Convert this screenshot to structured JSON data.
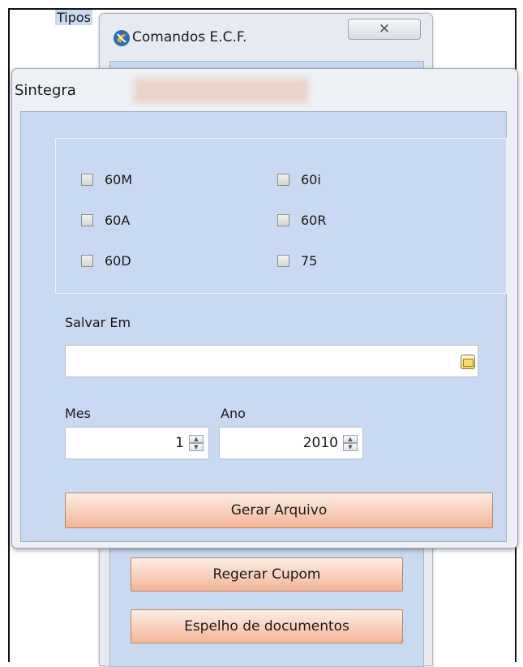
{
  "back_window": {
    "title": "Comandos E.C.F.",
    "close_symbol": "✕",
    "buttons": [
      "Regerar Cupom",
      "Espelho de documentos"
    ]
  },
  "sintegra": {
    "title": "Sintegra",
    "tipos_legend": "Tipos",
    "checkboxes": [
      {
        "label": "60M",
        "checked": false
      },
      {
        "label": "60A",
        "checked": false
      },
      {
        "label": "60D",
        "checked": false
      },
      {
        "label": "60i",
        "checked": false
      },
      {
        "label": "60R",
        "checked": false
      },
      {
        "label": "75",
        "checked": false
      }
    ],
    "salvar_em_label": "Salvar Em",
    "salvar_em_value": "",
    "mes_label": "Mes",
    "mes_value": "1",
    "ano_label": "Ano",
    "ano_value": "2010",
    "gerar_button": "Gerar Arquivo"
  },
  "icons": {
    "app": "app-logo-icon",
    "folder": "folder-icon",
    "spin_up": "up-arrow-icon",
    "spin_down": "down-arrow-icon"
  },
  "colors": {
    "client_bg": "#c8d9f1",
    "button_gradient_top": "#fdeee4",
    "button_gradient_bottom": "#f4b596"
  }
}
